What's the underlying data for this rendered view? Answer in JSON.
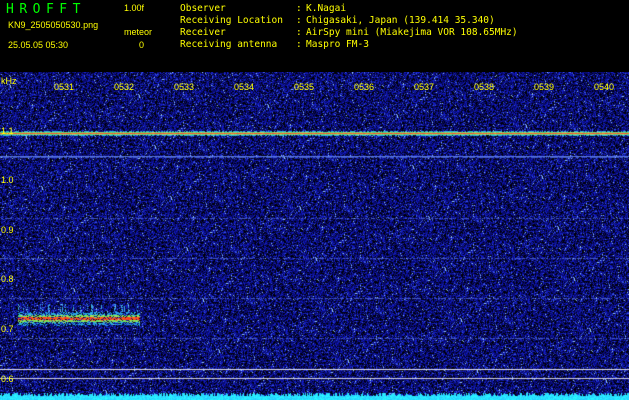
{
  "header": {
    "logo": "HROFFT",
    "version": "1.00f",
    "filename": "KN9_2505050530.png",
    "timestamp": "25.05.05 05:30",
    "meteor_label": "meteor",
    "meteor_count": "0",
    "info": [
      {
        "key": "Observer",
        "value": "K.Nagai"
      },
      {
        "key": "Receiving Location",
        "value": "Chigasaki, Japan (139.414 35.340)"
      },
      {
        "key": "Receiver",
        "value": "AirSpy mini (Miakejima VOR 108.65MHz)"
      },
      {
        "key": "Receiving antenna",
        "value": "Maspro FM-3"
      }
    ],
    "separator": ":"
  },
  "axis": {
    "unit": "kHz",
    "y_ticks": [
      "1.1",
      "1.0",
      "0.9",
      "0.8",
      "0.7",
      "0.6"
    ],
    "x_ticks": [
      "0531",
      "0532",
      "0533",
      "0534",
      "0535",
      "0536",
      "0537",
      "0538",
      "0539",
      "0540"
    ]
  },
  "colors": {
    "label": "#ffff00",
    "logo": "#00ff00",
    "background": "#000000",
    "noise": "#10148a",
    "carrier": "#ff3020"
  }
}
